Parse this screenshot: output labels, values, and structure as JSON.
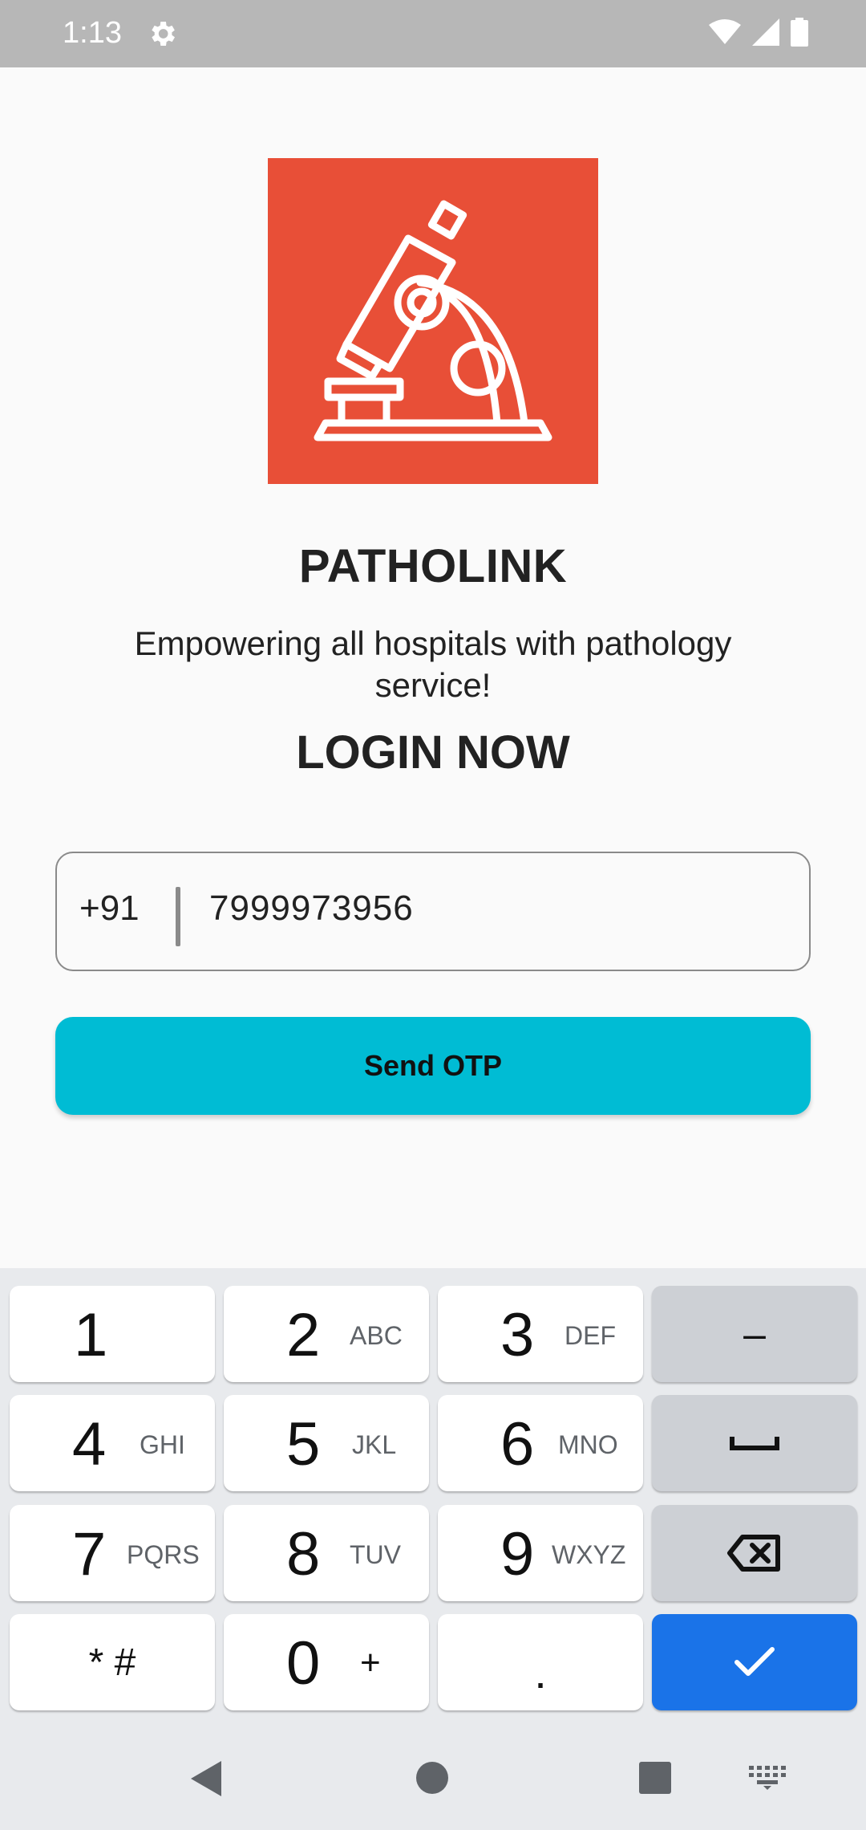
{
  "status_bar": {
    "time": "1:13",
    "icons": [
      "gear-icon",
      "wifi-icon",
      "signal-icon",
      "battery-icon"
    ],
    "background": "#b7b7b7"
  },
  "logo": {
    "icon": "microscope-icon",
    "background": "#e84f37"
  },
  "app_title": "PATHOLINK",
  "tagline": "Empowering all hospitals with pathology service!",
  "login_title": "LOGIN NOW",
  "phone_field": {
    "country_code": "+91",
    "value": "7999973956"
  },
  "send_button": {
    "label": "Send OTP",
    "color": "#00bcd4"
  },
  "keyboard": {
    "keys": [
      {
        "digit": "1",
        "letters": ""
      },
      {
        "digit": "2",
        "letters": "ABC"
      },
      {
        "digit": "3",
        "letters": "DEF"
      },
      {
        "digit": "4",
        "letters": "GHI"
      },
      {
        "digit": "5",
        "letters": "JKL"
      },
      {
        "digit": "6",
        "letters": "MNO"
      },
      {
        "digit": "7",
        "letters": "PQRS"
      },
      {
        "digit": "8",
        "letters": "TUV"
      },
      {
        "digit": "9",
        "letters": "WXYZ"
      },
      {
        "digit": "0",
        "letters": "+"
      }
    ],
    "minus": "–",
    "star_hash": "* #",
    "dot": ".",
    "action_color": "#1a73e8"
  },
  "nav_bar": {
    "icons": [
      "back-icon",
      "home-icon",
      "recents-icon",
      "keyboard-switch-icon"
    ]
  }
}
